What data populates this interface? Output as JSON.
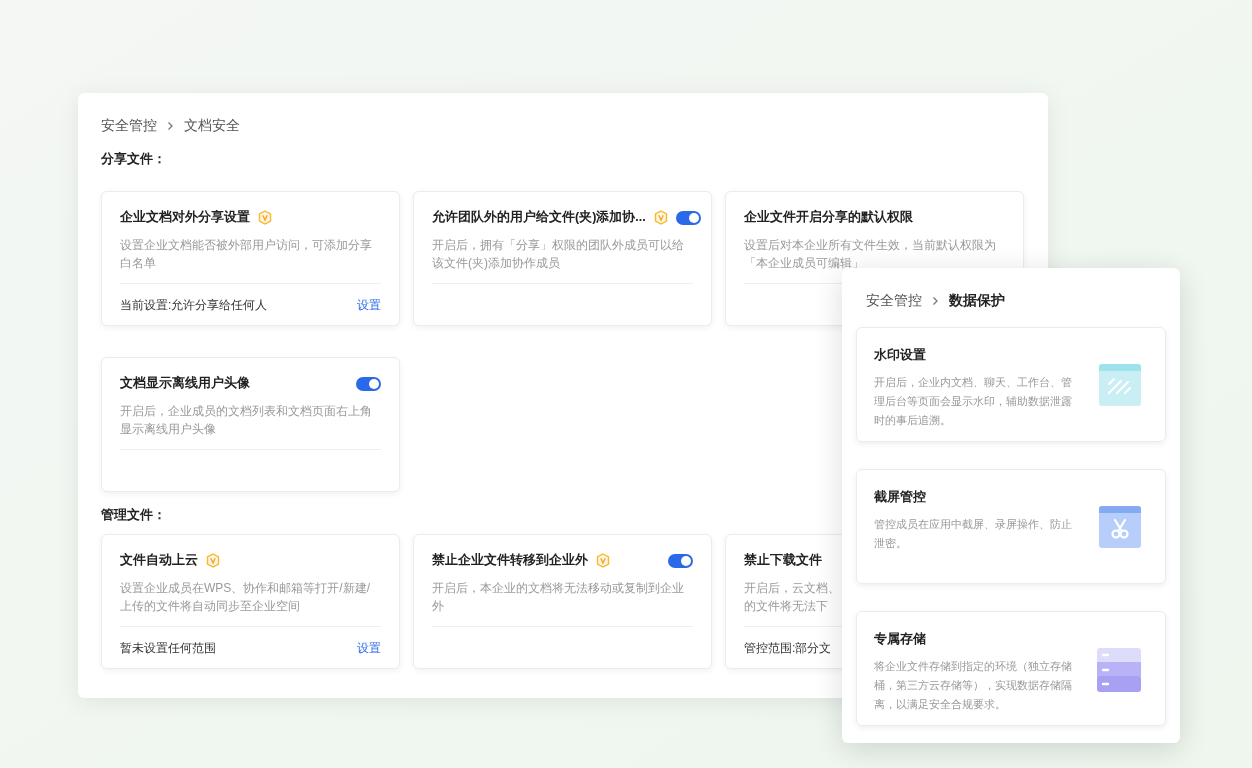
{
  "main_panel": {
    "breadcrumb": [
      {
        "text": "安全管控",
        "emphasized": false
      },
      {
        "text": "文档安全",
        "emphasized": false
      }
    ],
    "sections": [
      {
        "title": "分享文件：",
        "cards": [
          {
            "title": "企业文档对外分享设置",
            "badge": true,
            "description": [
              "设置企业文档能否被外部用户访问，可添加分享",
              "白名单"
            ],
            "footer": {
              "text": "当前设置:允许分享给任何人",
              "link": "设置"
            }
          },
          {
            "title": "允许团队外的用户给文件(夹)添加协...",
            "badge": true,
            "toggle": {
              "on": true
            },
            "description": [
              "开启后，拥有「分享」权限的团队外成员可以给",
              "该文件(夹)添加协作成员"
            ]
          },
          {
            "title": "企业文件开启分享的默认权限",
            "badge": false,
            "description": [
              "设置后对本企业所有文件生效，当前默认权限为",
              "「本企业成员可编辑」"
            ]
          },
          {
            "title": "文档显示离线用户头像",
            "badge": false,
            "toggle": {
              "on": true
            },
            "description": [
              "开启后，企业成员的文档列表和文档页面右上角",
              "显示离线用户头像"
            ]
          }
        ]
      },
      {
        "title": "管理文件：",
        "cards": [
          {
            "title": "文件自动上云",
            "badge": true,
            "description": [
              "设置企业成员在WPS、协作和邮箱等打开/新建/",
              "上传的文件将自动同步至企业空间"
            ],
            "footer": {
              "text": "暂未设置任何范围",
              "link": "设置"
            }
          },
          {
            "title": "禁止企业文件转移到企业外",
            "badge": true,
            "toggle": {
              "on": true
            },
            "description": [
              "开启后，本企业的文档将无法移动或复制到企业",
              "外"
            ]
          },
          {
            "title": "禁止下载文件",
            "badge": false,
            "description": [
              "开启后，云文档、",
              "的文件将无法下"
            ],
            "footer": {
              "text": "管控范围:部分文"
            }
          }
        ]
      }
    ]
  },
  "overlay_panel": {
    "breadcrumb": [
      {
        "text": "安全管控",
        "emphasized": false
      },
      {
        "text": "数据保护",
        "emphasized": true
      }
    ],
    "features": [
      {
        "kind": "watermark",
        "title": "水印设置",
        "description": [
          "开启后，企业内文档、聊天、工作台、管",
          "理后台等页面会显示水印，辅助数据泄露",
          "时的事后追溯。"
        ]
      },
      {
        "kind": "scissors",
        "title": "截屏管控",
        "description": [
          "管控成员在应用中截屏、录屏操作、防止",
          "泄密。"
        ]
      },
      {
        "kind": "storage",
        "title": "专属存储",
        "description": [
          "将企业文件存储到指定的环境（独立存储",
          "桶，第三方云存储等），实现数据存储隔",
          "离，以满足安全合规要求。"
        ]
      }
    ]
  }
}
